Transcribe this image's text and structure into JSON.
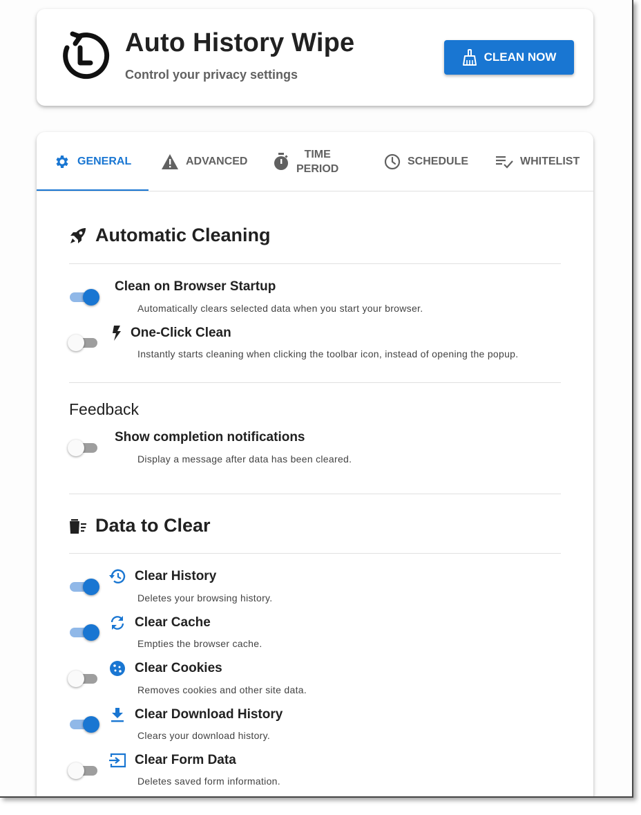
{
  "header": {
    "title": "Auto History Wipe",
    "subtitle": "Control your privacy settings",
    "clean_button": "CLEAN NOW",
    "accent_color": "#1976d2"
  },
  "tabs": [
    {
      "label": "GENERAL",
      "icon": "gear-icon",
      "active": true
    },
    {
      "label": "ADVANCED",
      "icon": "warning-icon",
      "active": false
    },
    {
      "label_line1": "TIME",
      "label_line2": "PERIOD",
      "icon": "stopwatch-icon",
      "active": false
    },
    {
      "label": "SCHEDULE",
      "icon": "clock-icon",
      "active": false
    },
    {
      "label": "WHITELIST",
      "icon": "checklist-icon",
      "active": false
    }
  ],
  "automatic_cleaning": {
    "title": "Automatic Cleaning",
    "icon": "rocket-icon",
    "options": [
      {
        "label": "Clean on Browser Startup",
        "desc": "Automatically clears selected data when you start your browser.",
        "enabled": true
      },
      {
        "label": "One-Click Clean",
        "desc": "Instantly starts cleaning when clicking the toolbar icon, instead of opening the popup.",
        "enabled": false,
        "icon": "lightning-icon"
      }
    ]
  },
  "feedback": {
    "title": "Feedback",
    "options": [
      {
        "label": "Show completion notifications",
        "desc": "Display a message after data has been cleared.",
        "enabled": false
      }
    ]
  },
  "data_to_clear": {
    "title": "Data to Clear",
    "icon": "trash-list-icon",
    "options": [
      {
        "label": "Clear History",
        "desc": "Deletes your browsing history.",
        "enabled": true,
        "icon": "history-icon"
      },
      {
        "label": "Clear Cache",
        "desc": "Empties the browser cache.",
        "enabled": true,
        "icon": "refresh-icon"
      },
      {
        "label": "Clear Cookies",
        "desc": "Removes cookies and other site data.",
        "enabled": false,
        "icon": "cookie-icon"
      },
      {
        "label": "Clear Download History",
        "desc": "Clears your download history.",
        "enabled": true,
        "icon": "download-icon"
      },
      {
        "label": "Clear Form Data",
        "desc": "Deletes saved form information.",
        "enabled": false,
        "icon": "form-input-icon"
      }
    ]
  }
}
